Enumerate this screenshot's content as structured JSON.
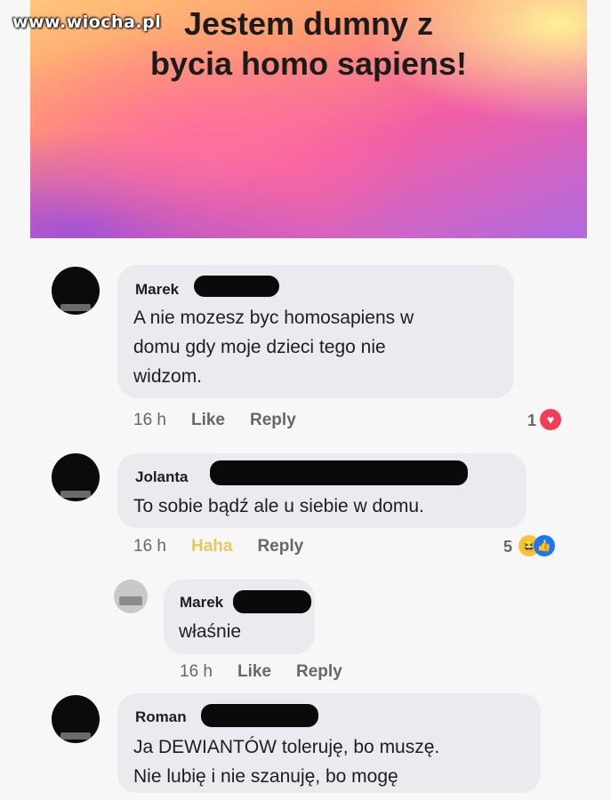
{
  "watermark": "www.wiocha.pl",
  "post": {
    "title_line1": "Jestem dumny z",
    "title_line2": "bycia homo sapiens!"
  },
  "comments": [
    {
      "author": "Marek",
      "text_lines": [
        "A nie mozesz byc homosapiens w",
        "domu gdy moje dzieci tego nie",
        "widzom."
      ],
      "time": "16 h",
      "action": "Like",
      "reply": "Reply",
      "reactions": "1"
    },
    {
      "author": "Jolanta",
      "text_lines": [
        "To sobie bądź ale u siebie w domu."
      ],
      "time": "16 h",
      "action": "Haha",
      "reply": "Reply",
      "reactions": "5"
    },
    {
      "author": "Marek",
      "text_lines": [
        "właśnie"
      ],
      "time": "16 h",
      "action": "Like",
      "reply": "Reply"
    },
    {
      "author": "Roman",
      "text_lines": [
        "Ja DEWIANTÓW toleruję, bo muszę.",
        "Nie lubię i nie szanuję, bo mogę"
      ]
    }
  ],
  "icons": {
    "heart": "heart-reaction-icon",
    "haha": "haha-reaction-icon",
    "like": "like-reaction-icon"
  },
  "colors": {
    "bubble": "#ebebef",
    "heart": "#f33e58",
    "haha": "#f7c53c",
    "like": "#1877f2"
  }
}
